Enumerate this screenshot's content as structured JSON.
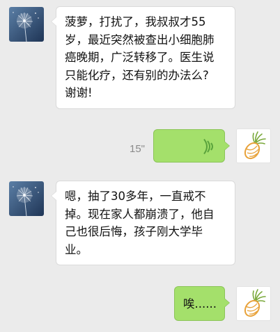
{
  "messages": [
    {
      "side": "left",
      "sender_avatar": "dandelion-avatar",
      "lines": [
        "菠萝，打扰了，我叔叔才55",
        "岁，最近突然被查出小细胞肺",
        "癌晚期，广泛转移了。医生说",
        "只能化疗，还有别的办法么?",
        "谢谢!"
      ]
    },
    {
      "side": "right",
      "type": "voice",
      "sender_avatar": "pineapple-avatar",
      "duration": "15\"",
      "voice_icon": "voice-wave-icon"
    },
    {
      "side": "left",
      "sender_avatar": "dandelion-avatar",
      "lines": [
        "嗯，抽了30多年，一直戒不",
        "掉。现在家人都崩溃了，他自",
        "己也很后悔，孩子刚大学毕",
        "业。"
      ]
    },
    {
      "side": "right",
      "sender_avatar": "pineapple-avatar",
      "text": "唉......"
    }
  ],
  "colors": {
    "background": "#ebebeb",
    "incoming_bubble": "#ffffff",
    "outgoing_bubble": "#a4e06b",
    "voice_icon": "#5aa33c"
  }
}
